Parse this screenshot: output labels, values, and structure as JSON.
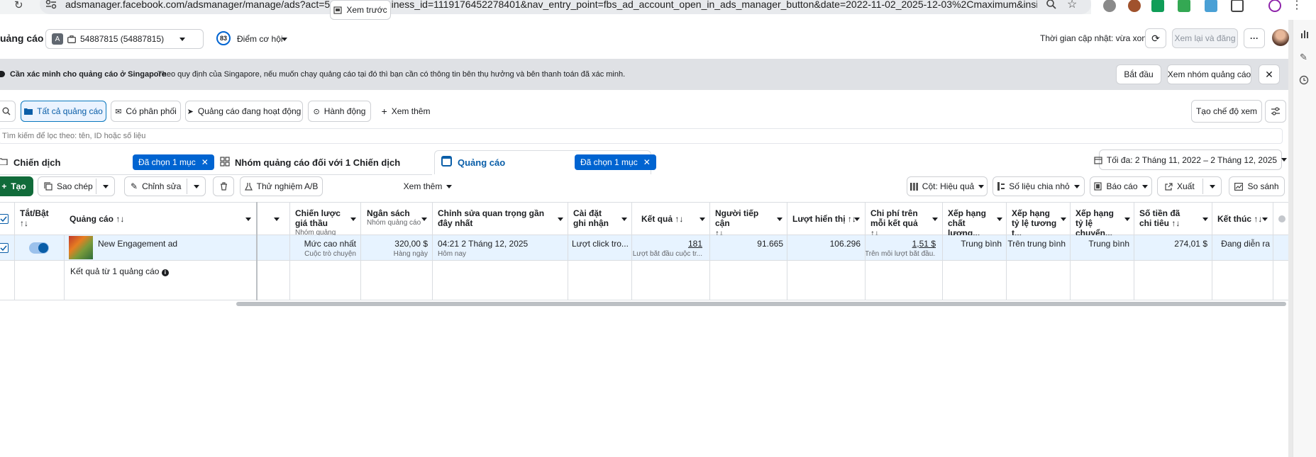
{
  "browser": {
    "url": "adsmanager.facebook.com/adsmanager/manage/ads?act=54887815&business_id=1119176452278401&nav_entry_point=fbs_ad_account_open_in_ads_manager_button&date=2022-11-02_2025-12-03%2Cmaximum&insi..."
  },
  "header": {
    "title": "uảng cáo",
    "account_badge": "A",
    "account_name": "54887815 (54887815)",
    "score_value": "83",
    "score_label": "Điểm cơ hội",
    "update_status": "Thời gian cập nhật: vừa xong",
    "review_publish": "Xem lại và đăng",
    "more": "···"
  },
  "banner": {
    "title": "Cần xác minh cho quảng cáo ở Singapore",
    "message": "Theo quy định của Singapore, nếu muốn chạy quảng cáo tại đó thì bạn cần có thông tin bên thụ hưởng và bên thanh toán đã xác minh.",
    "start_button": "Bắt đầu",
    "view_adset_button": "Xem nhóm quảng cáo"
  },
  "filters": {
    "all_ads": "Tất cả quảng cáo",
    "delivering": "Có phân phối",
    "active_ads": "Quảng cáo đang hoạt động",
    "actions": "Hành động",
    "see_more": "Xem thêm",
    "create_view": "Tạo chế độ xem",
    "search_placeholder": "Tìm kiếm để lọc theo: tên, ID hoặc số liệu"
  },
  "levels": {
    "campaign": "Chiến dịch",
    "campaign_selected": "Đã chọn 1 mục",
    "adset": "Nhóm quảng cáo đối với 1 Chiến dịch",
    "ads": "Quảng cáo",
    "ads_selected": "Đã chọn 1 mục",
    "date_range": "Tối đa: 2 Tháng 11, 2022 – 2 Tháng 12, 2025"
  },
  "toolbar": {
    "create": "Tạo",
    "duplicate": "Sao chép",
    "edit": "Chỉnh sửa",
    "ab_test": "Thử nghiệm A/B",
    "preview": "Xem trước",
    "more": "Xem thêm",
    "columns": "Cột: Hiệu quả",
    "breakdown": "Số liệu chia nhỏ",
    "reports": "Báo cáo",
    "export": "Xuất",
    "compare": "So sánh"
  },
  "table": {
    "headers": {
      "toggle": "Tắt/Bật",
      "ad": "Quảng cáo",
      "bid": "Chiến lược giá thầu",
      "bid_sub": "Nhóm quảng cáo",
      "budget": "Ngân sách",
      "budget_sub": "Nhóm quảng cáo",
      "last_edit": "Chỉnh sửa quan trọng gần đây nhất",
      "attribution": "Cài đặt ghi nhận",
      "results": "Kết quả",
      "reach": "Người tiếp cận",
      "impressions": "Lượt hiển thị",
      "cpr": "Chi phí trên mỗi kết quả",
      "quality": "Xếp hạng chất lượng...",
      "engagement": "Xếp hạng tỷ lệ tương t...",
      "conversion": "Xếp hạng tỷ lệ chuyển...",
      "spent": "Số tiền đã chi tiêu",
      "end": "Kết thúc",
      "sort": "↑↓"
    },
    "row": {
      "name": "New Engagement ad",
      "bid": "Mức cao nhất",
      "bid_sub": "Cuộc trò chuyện",
      "budget": "320,00 $",
      "budget_sub": "Hàng ngày",
      "last_edit": "04:21 2 Tháng 12, 2025",
      "last_edit_sub": "Hôm nay",
      "attribution": "Lượt click tro...",
      "results": "181",
      "results_sub": "Lượt bắt đầu cuộc tr...",
      "reach": "91.665",
      "impressions": "106.296",
      "cpr": "1,51 $",
      "cpr_sub": "Trên mỗi lượt bắt đầu...",
      "quality": "Trung bình",
      "engagement": "Trên trung bình",
      "conversion": "Trung bình",
      "spent": "274,01 $",
      "end": "Đang diễn ra"
    },
    "summary": "Kết quả từ 1 quảng cáo"
  }
}
